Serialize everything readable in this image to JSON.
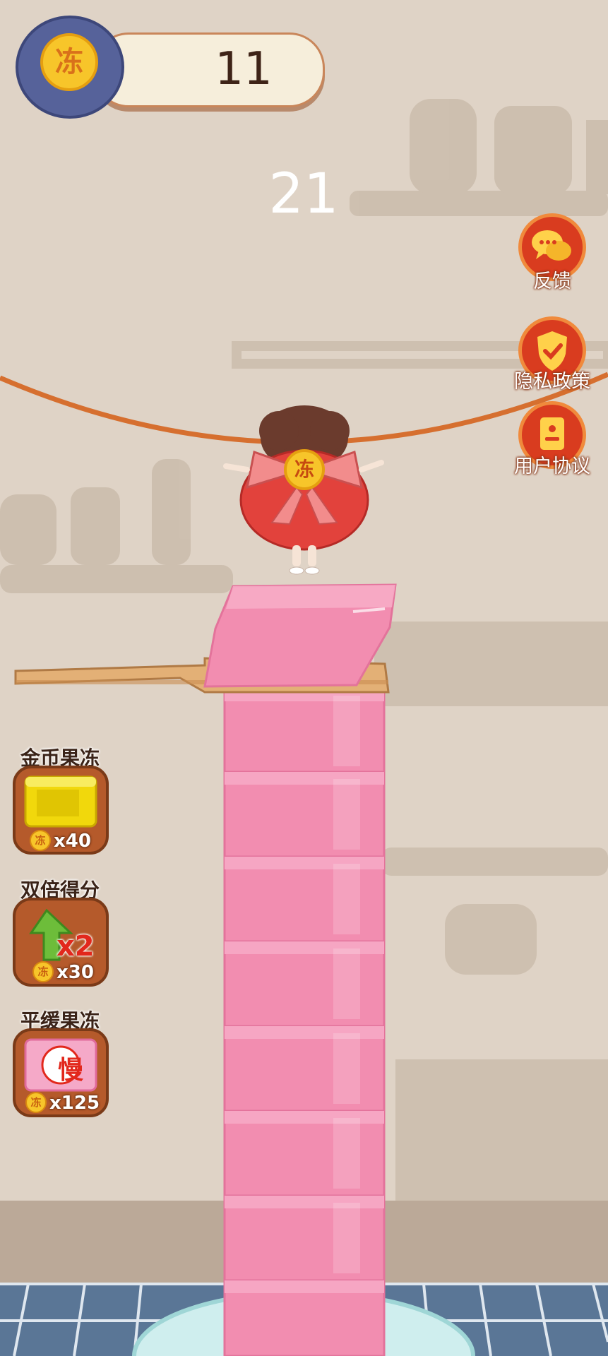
{
  "hud": {
    "coin_count": "11",
    "coin_glyph": "冻",
    "height_score": "21"
  },
  "side_menu": {
    "feedback": {
      "label": "反馈",
      "icon": "chat-bubbles-icon"
    },
    "privacy": {
      "label": "隐私政策",
      "icon": "shield-check-icon"
    },
    "agreement": {
      "label": "用户协议",
      "icon": "document-icon"
    }
  },
  "powerups": [
    {
      "label": "金币果冻",
      "cost": "x40",
      "icon": "gold-jelly-icon"
    },
    {
      "label": "双倍得分",
      "cost": "x30",
      "icon": "double-score-arrow-icon",
      "badge": "x2"
    },
    {
      "label": "平缓果冻",
      "cost": "x125",
      "icon": "slow-jelly-icon",
      "badge": "慢"
    }
  ],
  "character": {
    "badge": "冻"
  },
  "colors": {
    "wall": "#dfd3c6",
    "jelly": "#f28db0",
    "side_button": "#d93c1f",
    "floor": "#5a7696"
  }
}
